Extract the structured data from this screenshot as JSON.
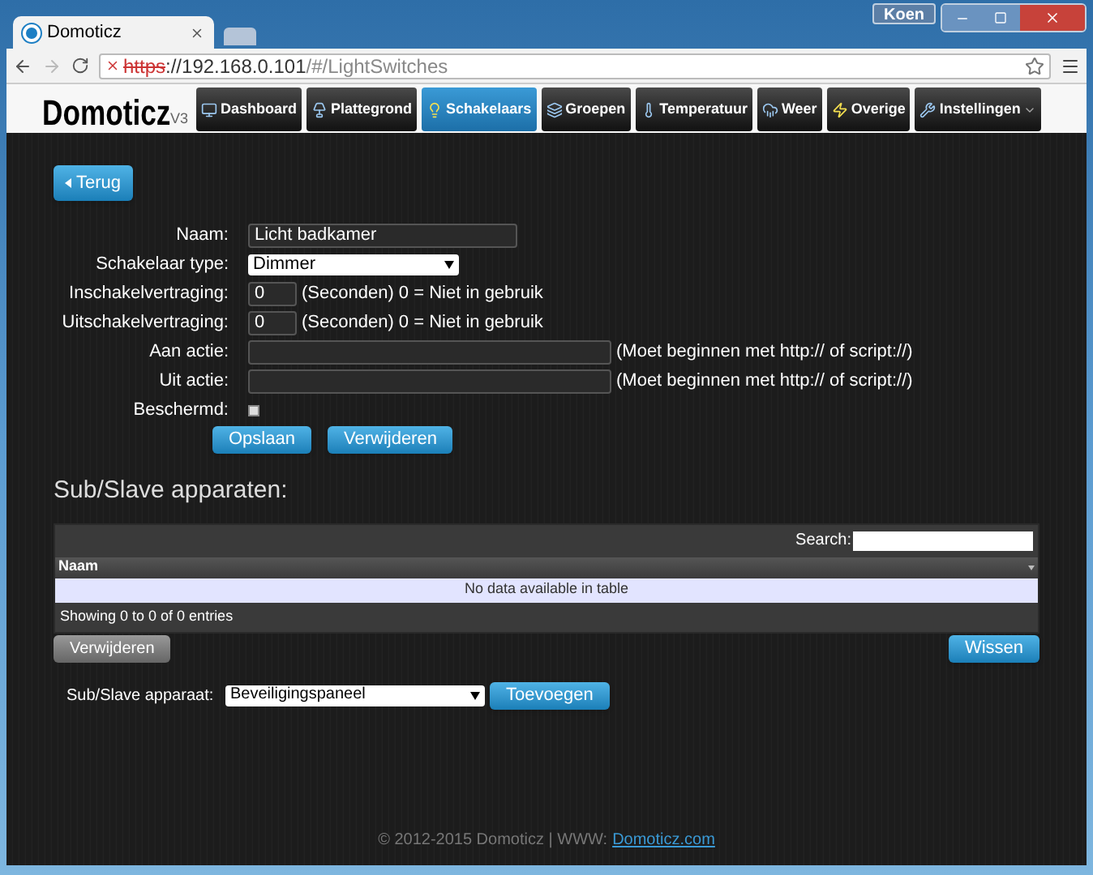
{
  "browser": {
    "tab_title": "Domoticz",
    "user": "Koen",
    "url": {
      "scheme": "https",
      "host": "://192.168.0.101",
      "path": "/#/LightSwitches"
    }
  },
  "app": {
    "logo": "Domoticz",
    "version": "V3"
  },
  "nav": [
    {
      "label": "Dashboard",
      "kind": "monitor",
      "selected": false
    },
    {
      "label": "Plattegrond",
      "kind": "floorplan",
      "selected": false
    },
    {
      "label": "Schakelaars",
      "kind": "bulb",
      "selected": true
    },
    {
      "label": "Groepen",
      "kind": "group",
      "selected": false
    },
    {
      "label": "Temperatuur",
      "kind": "thermo",
      "selected": false
    },
    {
      "label": "Weer",
      "kind": "weather",
      "selected": false
    },
    {
      "label": "Overige",
      "kind": "utility",
      "selected": false
    },
    {
      "label": "Instellingen",
      "kind": "settings",
      "selected": false,
      "dropdown": true
    }
  ],
  "back_button": "Terug",
  "form": [
    {
      "label": "Naam:",
      "kind": "text",
      "value": "Licht badkamer"
    },
    {
      "label": "Schakelaar type:",
      "kind": "select",
      "value": "Dimmer"
    },
    {
      "label": "Inschakelvertraging:",
      "kind": "short",
      "value": "0",
      "hint": "(Seconden) 0 = Niet in gebruik"
    },
    {
      "label": "Uitschakelvertraging:",
      "kind": "short",
      "value": "0",
      "hint": "(Seconden) 0 = Niet in gebruik"
    },
    {
      "label": "Aan actie:",
      "kind": "long",
      "hint": "(Moet beginnen met http:// of script://)"
    },
    {
      "label": "Uit actie:",
      "kind": "long",
      "hint": "(Moet beginnen met http:// of script://)"
    },
    {
      "label": "Beschermd:",
      "kind": "checkbox",
      "checked": false
    }
  ],
  "form_buttons": [
    "Opslaan",
    "Verwijderen"
  ],
  "sub_slave": {
    "heading": "Sub/Slave apparaten:",
    "search_label": "Search:",
    "columns": [
      "Naam"
    ],
    "empty": "No data available in table",
    "info": "Showing 0 to 0 of 0 entries",
    "delete_button": "Verwijderen",
    "clear_button": "Wissen",
    "device_label": "Sub/Slave apparaat:",
    "device_value": "Beveiligingspaneel",
    "add_button": "Toevoegen"
  },
  "footer": {
    "text": "© 2012-2015 Domoticz | WWW:",
    "link": "Domoticz.com"
  }
}
